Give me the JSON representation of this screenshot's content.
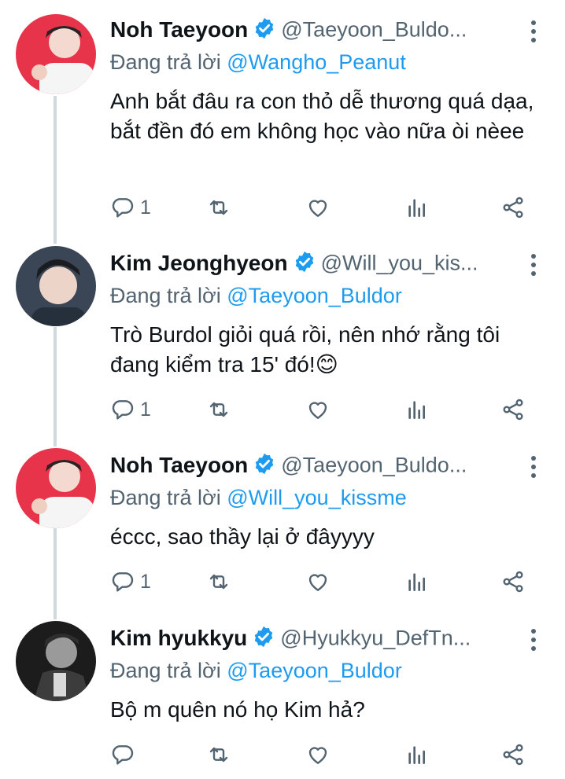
{
  "tweets": [
    {
      "name": "Noh Taeyoon",
      "handle": "@Taeyoon_Buldo...",
      "reply_prefix": "Đang trả lời ",
      "reply_to": "@Wangho_Peanut",
      "text": "Anh bắt đâu ra con thỏ dễ thương quá dạa, bắt đền đó em không học vào nữa òi nèee",
      "reply_count": "1"
    },
    {
      "name": "Kim Jeonghyeon",
      "handle": "@Will_you_kis...",
      "reply_prefix": "Đang trả lời ",
      "reply_to": "@Taeyoon_Buldor",
      "text": "Trò Burdol giỏi quá rồi, nên nhớ rằng tôi đang kiểm tra 15' đó!😊",
      "reply_count": "1"
    },
    {
      "name": "Noh Taeyoon",
      "handle": "@Taeyoon_Buldo...",
      "reply_prefix": "Đang trả lời ",
      "reply_to": "@Will_you_kissme",
      "text": "éccc, sao thầy lại ở đâyyyy",
      "reply_count": "1"
    },
    {
      "name": "Kim hyukkyu",
      "handle": "@Hyukkyu_DefTn...",
      "reply_prefix": "Đang trả lời ",
      "reply_to": "@Taeyoon_Buldor",
      "text": "Bộ m quên nó họ Kim hả?",
      "reply_count": ""
    }
  ],
  "colors": {
    "accent": "#1d9bf0",
    "secondary_text": "#536471",
    "thread_line": "#cfd9de"
  },
  "icons": [
    "verified-badge-icon",
    "more-vertical-icon",
    "reply-icon",
    "retweet-icon",
    "like-icon",
    "views-icon",
    "share-icon"
  ]
}
